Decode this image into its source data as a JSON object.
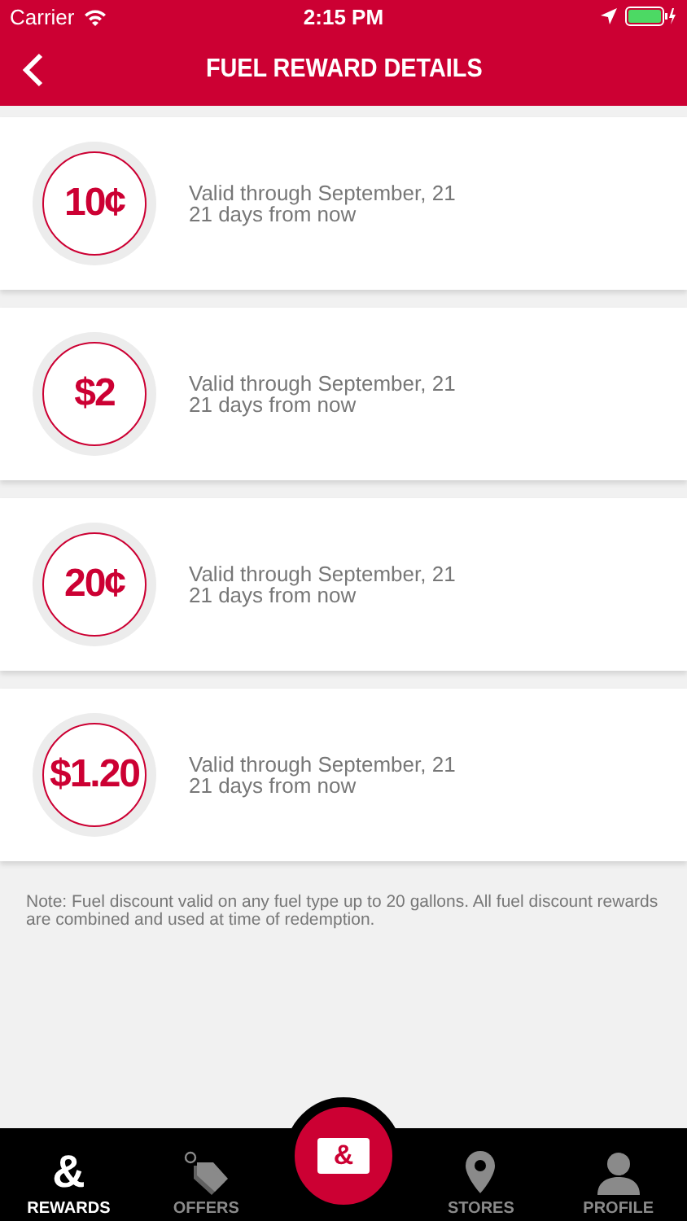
{
  "status_bar": {
    "carrier": "Carrier",
    "time": "2:15 PM"
  },
  "nav": {
    "title": "FUEL REWARD DETAILS"
  },
  "rewards": [
    {
      "amount": "10¢",
      "valid": "Valid through September, 21",
      "remaining": "21 days from now"
    },
    {
      "amount": "$2",
      "valid": "Valid through September, 21",
      "remaining": "21 days from now"
    },
    {
      "amount": "20¢",
      "valid": "Valid through September, 21",
      "remaining": "21 days from now"
    },
    {
      "amount": "$1.20",
      "valid": "Valid through September, 21",
      "remaining": "21 days from now"
    }
  ],
  "note": "Note: Fuel discount valid on any fuel type up to 20 gallons. All fuel discount rewards are combined and used at time of redemption.",
  "tab_bar": {
    "center_glyph": "&",
    "tabs": [
      {
        "label": "REWARDS",
        "kind": "glyph",
        "glyph": "&",
        "selected": true
      },
      {
        "label": "OFFERS",
        "kind": "tag",
        "selected": false
      },
      {
        "kind": "center"
      },
      {
        "label": "STORES",
        "kind": "pin",
        "selected": false
      },
      {
        "label": "PROFILE",
        "kind": "person",
        "selected": false
      }
    ]
  }
}
